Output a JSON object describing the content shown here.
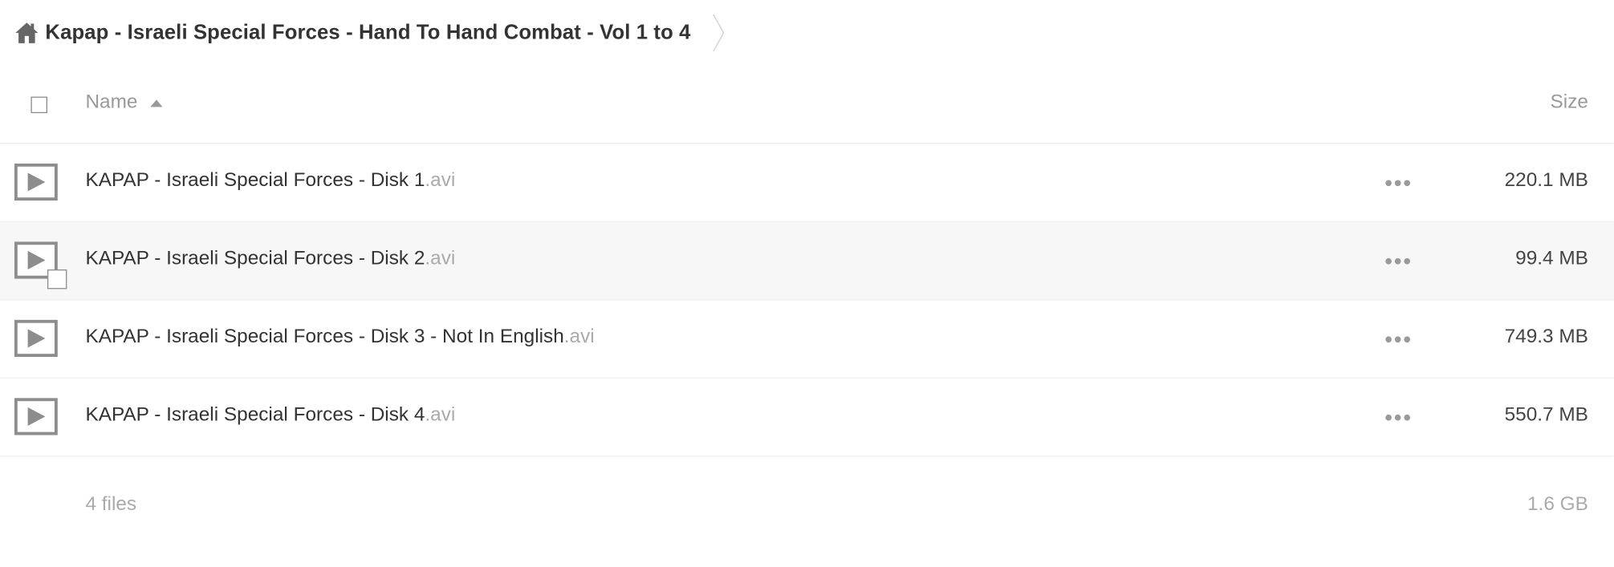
{
  "breadcrumb": {
    "home_icon": "home-icon",
    "folder": "Kapap - Israeli Special Forces - Hand To Hand Combat - Vol 1 to 4"
  },
  "header": {
    "name_label": "Name",
    "size_label": "Size",
    "sort": "ascending"
  },
  "files": [
    {
      "base": "KAPAP - Israeli Special Forces - Disk 1",
      "ext": ".avi",
      "size": "220.1 MB"
    },
    {
      "base": "KAPAP - Israeli Special Forces - Disk 2",
      "ext": ".avi",
      "size": "99.4 MB"
    },
    {
      "base": "KAPAP - Israeli Special Forces - Disk 3 - Not In English",
      "ext": ".avi",
      "size": "749.3 MB"
    },
    {
      "base": "KAPAP - Israeli Special Forces - Disk 4",
      "ext": ".avi",
      "size": "550.7 MB"
    }
  ],
  "footer": {
    "count": "4 files",
    "total": "1.6 GB"
  },
  "colors": {
    "text": "#333333",
    "muted": "#999999",
    "icon": "#8d8d8d",
    "hover_row": "#f7f7f7"
  }
}
